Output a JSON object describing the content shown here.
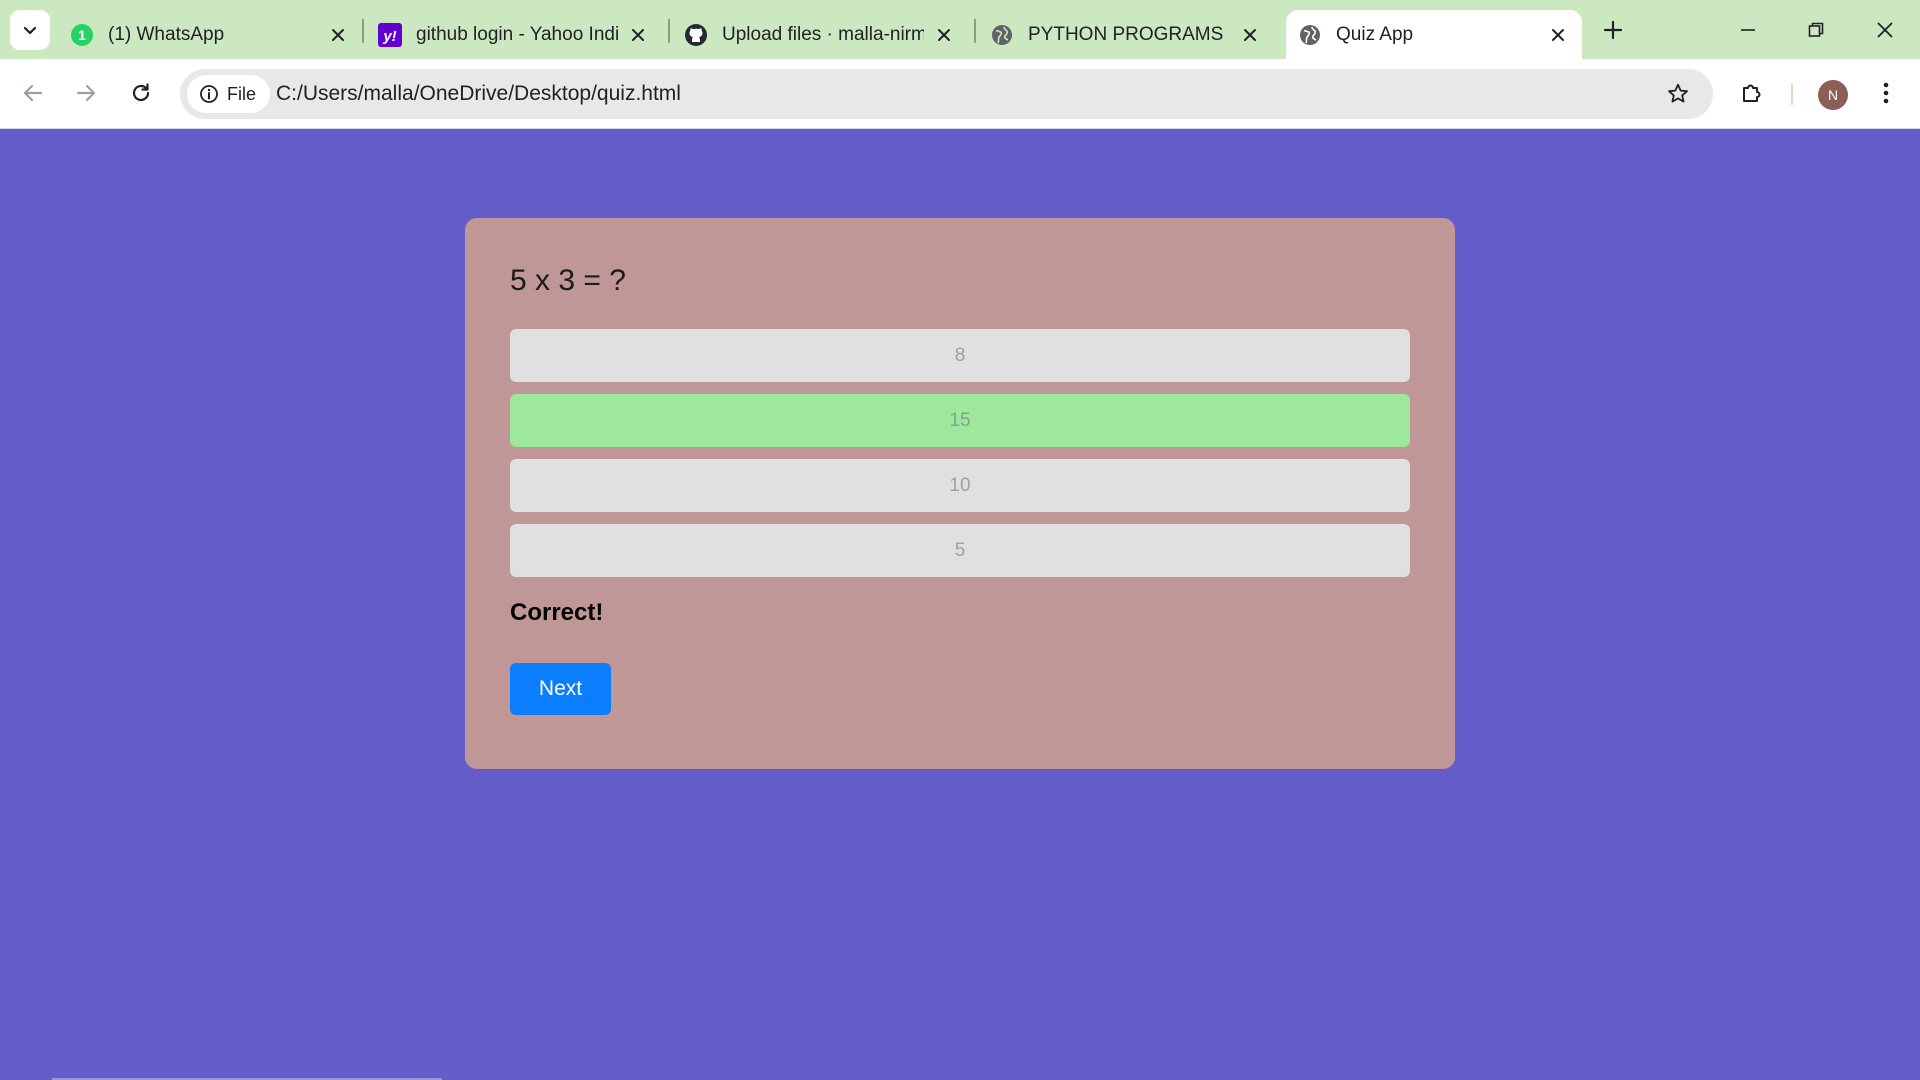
{
  "browser": {
    "tabs": [
      {
        "title": "(1) WhatsApp",
        "icon": "whatsapp-icon",
        "badge": "1",
        "active": false
      },
      {
        "title": "github login - Yahoo India",
        "icon": "yahoo-icon",
        "active": false
      },
      {
        "title": "Upload files · malla-nirmala",
        "icon": "github-icon",
        "active": false
      },
      {
        "title": "PYTHON PROGRAMS",
        "icon": "globe-icon",
        "active": false
      },
      {
        "title": "Quiz App",
        "icon": "globe-icon",
        "active": true
      }
    ],
    "yahoo_logo_text": "y!",
    "address_chip": "File",
    "url": "C:/Users/malla/OneDrive/Desktop/quiz.html",
    "profile_initial": "N",
    "accent_colors": {
      "tabstrip": "#cce8c1",
      "page_bg": "#645cc9",
      "card_bg": "#bf9797",
      "correct": "#9ee89e",
      "next_button": "#0b7dff"
    }
  },
  "quiz": {
    "question": "5 x 3 = ?",
    "options": [
      {
        "label": "8",
        "state": "disabled"
      },
      {
        "label": "15",
        "state": "correct"
      },
      {
        "label": "10",
        "state": "disabled"
      },
      {
        "label": "5",
        "state": "disabled"
      }
    ],
    "feedback": "Correct!",
    "next_label": "Next"
  }
}
